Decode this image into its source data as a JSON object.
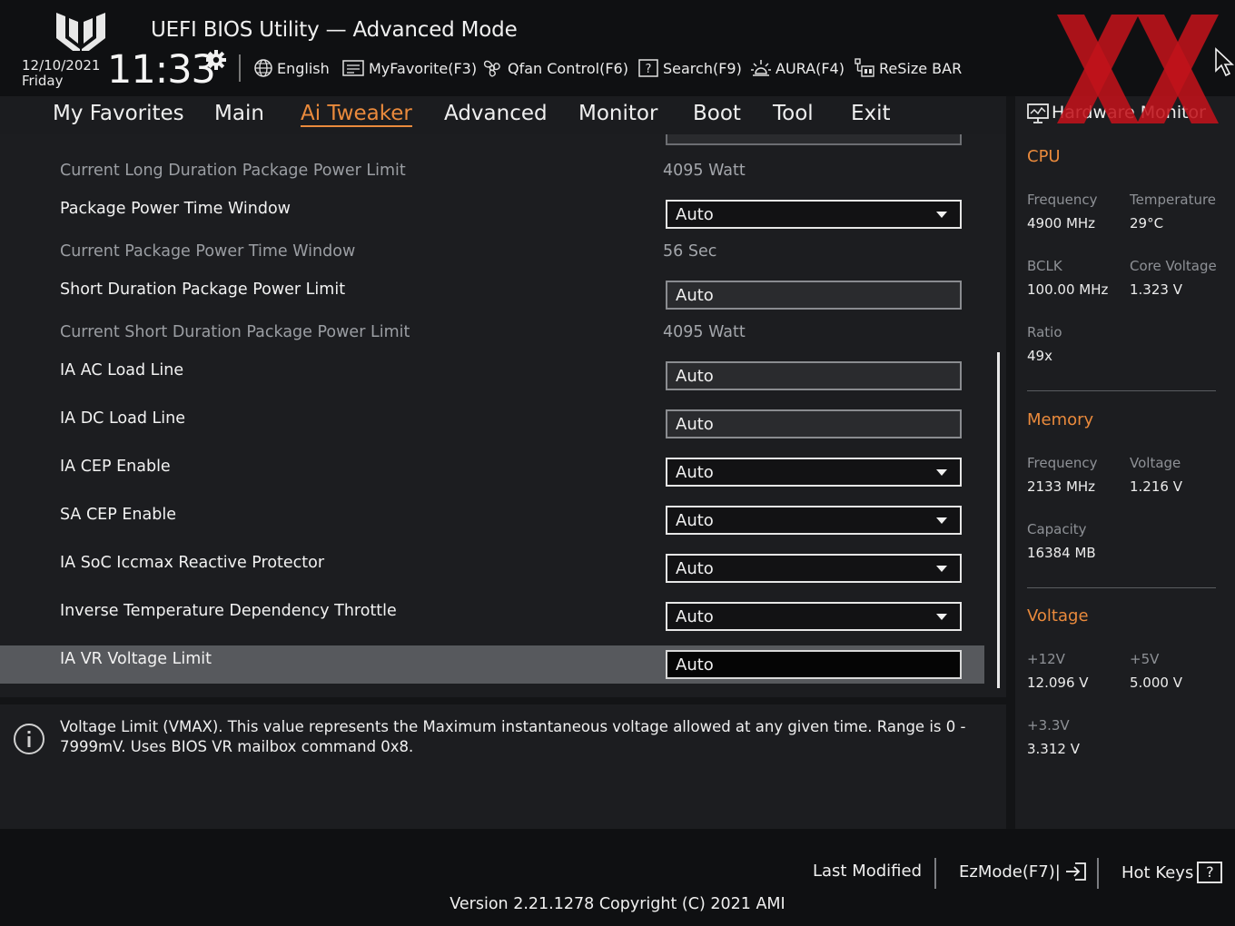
{
  "header": {
    "title": "UEFI BIOS Utility — Advanced Mode",
    "date": "12/10/2021",
    "day": "Friday",
    "time": "11:33",
    "tools": [
      {
        "label": "English",
        "icon": "globe-icon"
      },
      {
        "label": "MyFavorite(F3)",
        "icon": "favorite-list-icon"
      },
      {
        "label": "Qfan Control(F6)",
        "icon": "fan-icon"
      },
      {
        "label": "Search(F9)",
        "icon": "search-help-icon"
      },
      {
        "label": "AURA(F4)",
        "icon": "aura-light-icon"
      },
      {
        "label": "ReSize BAR",
        "icon": "resize-bar-icon"
      }
    ]
  },
  "nav": {
    "tabs": [
      "My Favorites",
      "Main",
      "Ai Tweaker",
      "Advanced",
      "Monitor",
      "Boot",
      "Tool",
      "Exit"
    ],
    "active": "Ai Tweaker"
  },
  "settings": {
    "rows": [
      {
        "label": "Current Long Duration Package Power Limit",
        "kind": "info",
        "value": "4095 Watt"
      },
      {
        "label": "Package Power Time Window",
        "kind": "dropdown",
        "value": "Auto"
      },
      {
        "label": "Current Package Power Time Window",
        "kind": "info",
        "value": "56 Sec"
      },
      {
        "label": "Short Duration Package Power Limit",
        "kind": "input",
        "value": "Auto"
      },
      {
        "label": "Current Short Duration Package Power Limit",
        "kind": "info",
        "value": "4095 Watt"
      },
      {
        "label": "IA AC Load Line",
        "kind": "input",
        "value": "Auto"
      },
      {
        "label": "IA DC Load Line",
        "kind": "input",
        "value": "Auto"
      },
      {
        "label": "IA CEP Enable",
        "kind": "dropdown",
        "value": "Auto"
      },
      {
        "label": "SA CEP Enable",
        "kind": "dropdown",
        "value": "Auto"
      },
      {
        "label": "IA SoC Iccmax Reactive Protector",
        "kind": "dropdown",
        "value": "Auto"
      },
      {
        "label": "Inverse Temperature Dependency Throttle",
        "kind": "dropdown",
        "value": "Auto"
      },
      {
        "label": "IA VR Voltage Limit",
        "kind": "input",
        "value": "Auto",
        "selected": true
      }
    ]
  },
  "help": {
    "text": "Voltage Limit (VMAX). This value represents the Maximum instantaneous voltage allowed at any given time. Range is 0 - 7999mV. Uses BIOS VR mailbox command 0x8."
  },
  "hwmonitor": {
    "title": "Hardware Monitor",
    "cpu": {
      "heading": "CPU",
      "frequency_label": "Frequency",
      "frequency": "4900 MHz",
      "temperature_label": "Temperature",
      "temperature": "29°C",
      "bclk_label": "BCLK",
      "bclk": "100.00 MHz",
      "core_voltage_label": "Core Voltage",
      "core_voltage": "1.323 V",
      "ratio_label": "Ratio",
      "ratio": "49x"
    },
    "memory": {
      "heading": "Memory",
      "frequency_label": "Frequency",
      "frequency": "2133 MHz",
      "voltage_label": "Voltage",
      "voltage": "1.216 V",
      "capacity_label": "Capacity",
      "capacity": "16384 MB"
    },
    "voltage": {
      "heading": "Voltage",
      "v12_label": "+12V",
      "v12": "12.096 V",
      "v5_label": "+5V",
      "v5": "5.000 V",
      "v33_label": "+3.3V",
      "v33": "3.312 V"
    }
  },
  "footer": {
    "last_modified": "Last Modified",
    "ezmode": "EzMode(F7)|",
    "hotkeys": "Hot Keys",
    "hotkeys_box": "?",
    "version": "Version 2.21.1278 Copyright (C) 2021 AMI"
  },
  "colors": {
    "accent": "#ea8a3c",
    "watermark": "#c0121a"
  }
}
